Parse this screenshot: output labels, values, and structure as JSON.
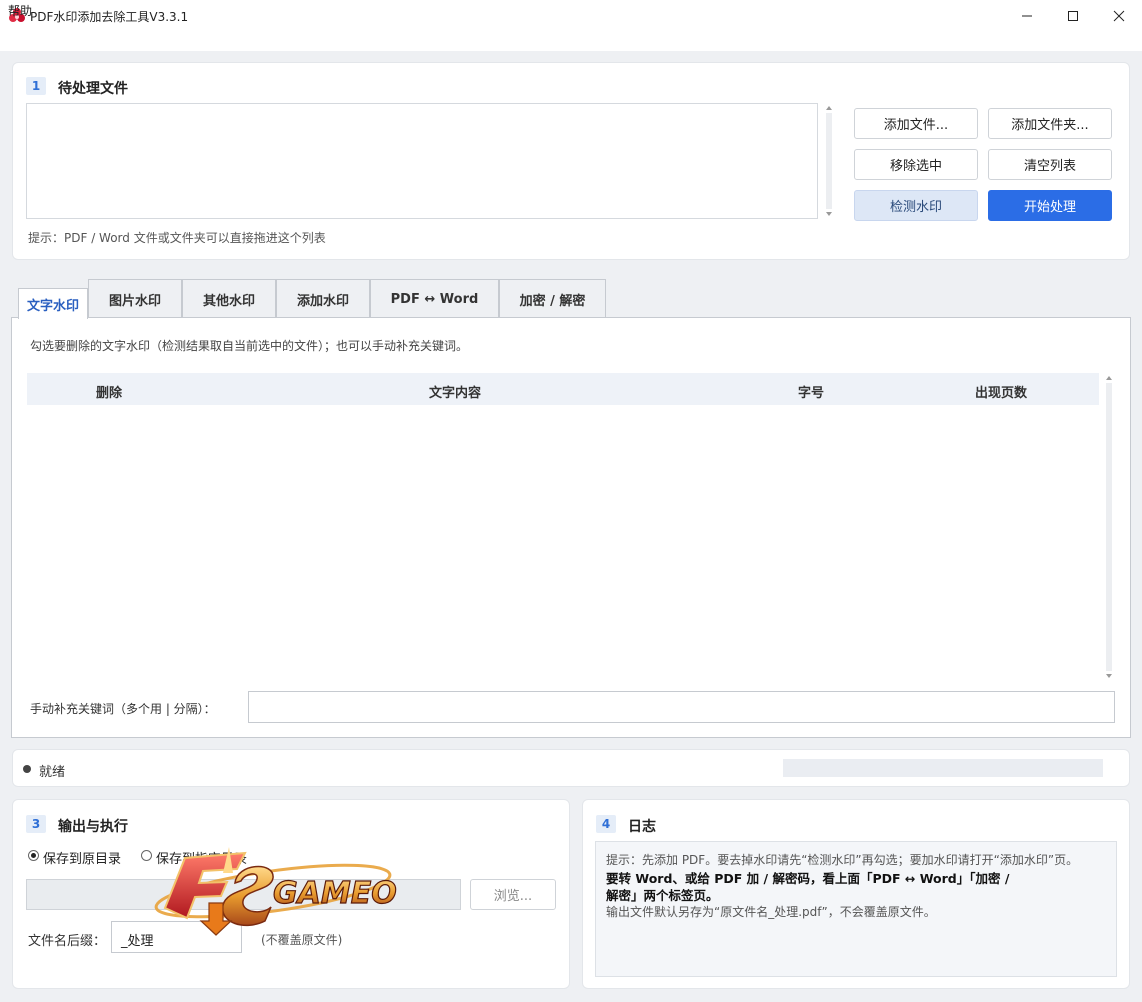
{
  "window": {
    "title": "PDF水印添加去除工具V3.3.1"
  },
  "menu": {
    "help": "帮助"
  },
  "section1": {
    "num": "1",
    "title": "待处理文件",
    "buttons": {
      "add_file": "添加文件...",
      "add_folder": "添加文件夹...",
      "remove_selected": "移除选中",
      "clear_list": "清空列表",
      "detect_watermark": "检测水印",
      "start": "开始处理"
    },
    "hint": "提示：PDF / Word 文件或文件夹可以直接拖进这个列表"
  },
  "tabs": [
    {
      "label": "文字水印",
      "active": true
    },
    {
      "label": "图片水印"
    },
    {
      "label": "其他水印"
    },
    {
      "label": "添加水印"
    },
    {
      "label": "PDF ↔ Word"
    },
    {
      "label": "加密 / 解密"
    }
  ],
  "text_tab": {
    "description": "勾选要删除的文字水印（检测结果取自当前选中的文件）；也可以手动补充关键词。",
    "columns": [
      "删除",
      "文字内容",
      "字号",
      "出现页数"
    ],
    "keyword_label": "手动补充关键词（多个用 | 分隔）：",
    "keyword_value": ""
  },
  "status": {
    "text": "就绪",
    "progress": 0
  },
  "section3": {
    "num": "3",
    "title": "输出与执行",
    "radio_original": "保存到原目录",
    "radio_custom": "保存到指定目录",
    "selected": "original",
    "outdir_value": "",
    "browse": "浏览...",
    "suffix_label": "文件名后缀：",
    "suffix_value": "_处理",
    "suffix_note": "(不覆盖原文件)"
  },
  "section4": {
    "num": "4",
    "title": "日志",
    "lines": [
      "提示：先添加 PDF。要去掉水印请先“检测水印”再勾选；要加水印请打开“添加水印”页。",
      "要转 Word、或给 PDF 加 / 解密码，看上面「PDF ↔ Word」「加密 /",
      "解密」两个标签页。",
      "输出文件默认另存为“原文件名_处理.pdf”，不会覆盖原文件。"
    ]
  },
  "watermark": {
    "text": "GAMEO",
    "letters": "FS"
  },
  "colors": {
    "primary": "#2b6de6",
    "accent_text": "#2a5fc0",
    "badge_bg": "#e5edf8"
  }
}
